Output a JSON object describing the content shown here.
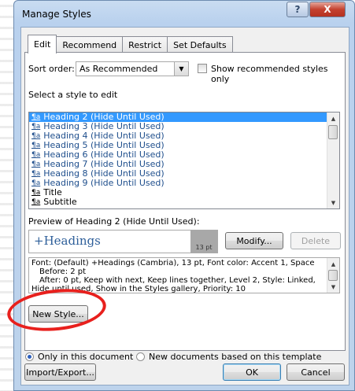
{
  "window": {
    "title": "Manage Styles",
    "help_glyph": "?",
    "close_glyph": "X"
  },
  "tabs": [
    {
      "label": "Edit",
      "active": true
    },
    {
      "label": "Recommend",
      "active": false
    },
    {
      "label": "Restrict",
      "active": false
    },
    {
      "label": "Set Defaults",
      "active": false
    }
  ],
  "sort": {
    "label": "Sort order:",
    "value": "As Recommended",
    "show_recommended_label": "Show recommended styles only",
    "show_recommended_checked": false
  },
  "select_label": "Select a style to edit",
  "styles_list": [
    {
      "label": "Heading 2  (Hide Until Used)",
      "selected": true
    },
    {
      "label": "Heading 3  (Hide Until Used)",
      "selected": false
    },
    {
      "label": "Heading 4  (Hide Until Used)",
      "selected": false
    },
    {
      "label": "Heading 5  (Hide Until Used)",
      "selected": false
    },
    {
      "label": "Heading 6  (Hide Until Used)",
      "selected": false
    },
    {
      "label": "Heading 7  (Hide Until Used)",
      "selected": false
    },
    {
      "label": "Heading 8  (Hide Until Used)",
      "selected": false
    },
    {
      "label": "Heading 9  (Hide Until Used)",
      "selected": false
    },
    {
      "label": "Title",
      "selected": false
    },
    {
      "label": "Subtitle",
      "selected": false
    }
  ],
  "preview": {
    "label": "Preview of Heading 2  (Hide Until Used):",
    "text": "+Headings",
    "size": "13 pt",
    "text_color": "#2e5f9a"
  },
  "buttons": {
    "modify": "Modify...",
    "delete": "Delete",
    "new_style": "New Style...",
    "import_export": "Import/Export...",
    "ok": "OK",
    "cancel": "Cancel"
  },
  "description": {
    "line1": "Font: (Default) +Headings (Cambria), 13 pt, Font color: Accent 1, Space",
    "line2": "Before:  2 pt",
    "line3": "After:  0 pt, Keep with next, Keep lines together, Level 2, Style: Linked,",
    "line4": "Hide until used, Show in the Styles gallery, Priority: 10"
  },
  "scope": {
    "only_this_document": "Only in this document",
    "new_documents": "New documents based on this template",
    "selected": "only_this_document"
  },
  "colors": {
    "selection": "#3399ff",
    "highlight_ring": "#e8201d",
    "link_text": "#1e4e8c"
  }
}
